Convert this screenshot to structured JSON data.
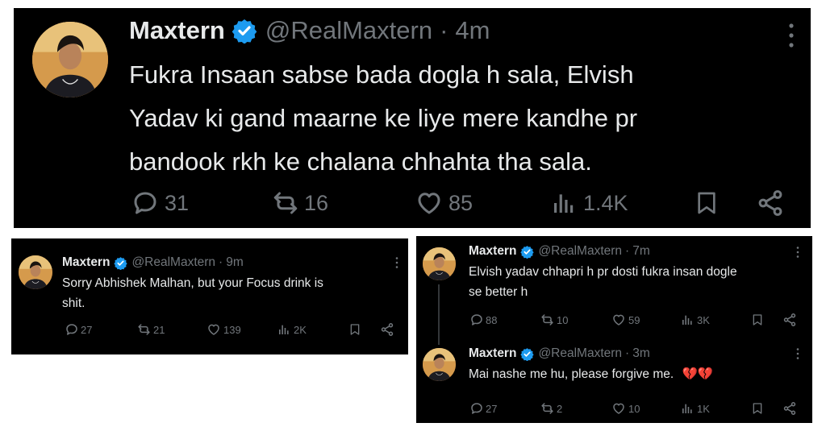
{
  "tweets": [
    {
      "name": "Maxtern",
      "handle": "@RealMaxtern",
      "separator": "·",
      "time": "4m",
      "text_lines": [
        "Fukra Insaan sabse bada dogla h sala, Elvish",
        "Yadav ki gand maarne ke liye mere kandhe pr",
        "bandook rkh ke chalana chhahta tha sala."
      ],
      "stats": {
        "replies": "31",
        "retweets": "16",
        "likes": "85",
        "views": "1.4K"
      }
    },
    {
      "name": "Maxtern",
      "handle": "@RealMaxtern",
      "separator": "·",
      "time": "9m",
      "text_lines": [
        "Sorry Abhishek Malhan, but your Focus drink is",
        "shit."
      ],
      "stats": {
        "replies": "27",
        "retweets": "21",
        "likes": "139",
        "views": "2K"
      }
    },
    {
      "name": "Maxtern",
      "handle": "@RealMaxtern",
      "separator": "·",
      "time": "7m",
      "text_lines": [
        "Elvish yadav chhapri h pr dosti fukra insan dogle",
        "se better h"
      ],
      "stats": {
        "replies": "88",
        "retweets": "10",
        "likes": "59",
        "views": "3K"
      }
    },
    {
      "name": "Maxtern",
      "handle": "@RealMaxtern",
      "separator": "·",
      "time": "3m",
      "text_lines": [
        "Mai nashe me hu, please forgive me."
      ],
      "emoji": "💔💔",
      "stats": {
        "replies": "27",
        "retweets": "2",
        "likes": "10",
        "views": "1K"
      }
    }
  ],
  "icons": {
    "reply": "reply-icon",
    "retweet": "retweet-icon",
    "like": "heart-icon",
    "views": "views-icon",
    "bookmark": "bookmark-icon",
    "share": "share-icon",
    "more": "more-options-icon",
    "verified": "verified-badge-icon"
  },
  "colors": {
    "background": "#000000",
    "text": "#e7e9ea",
    "secondary": "#71767b",
    "verified": "#1d9bf0"
  }
}
